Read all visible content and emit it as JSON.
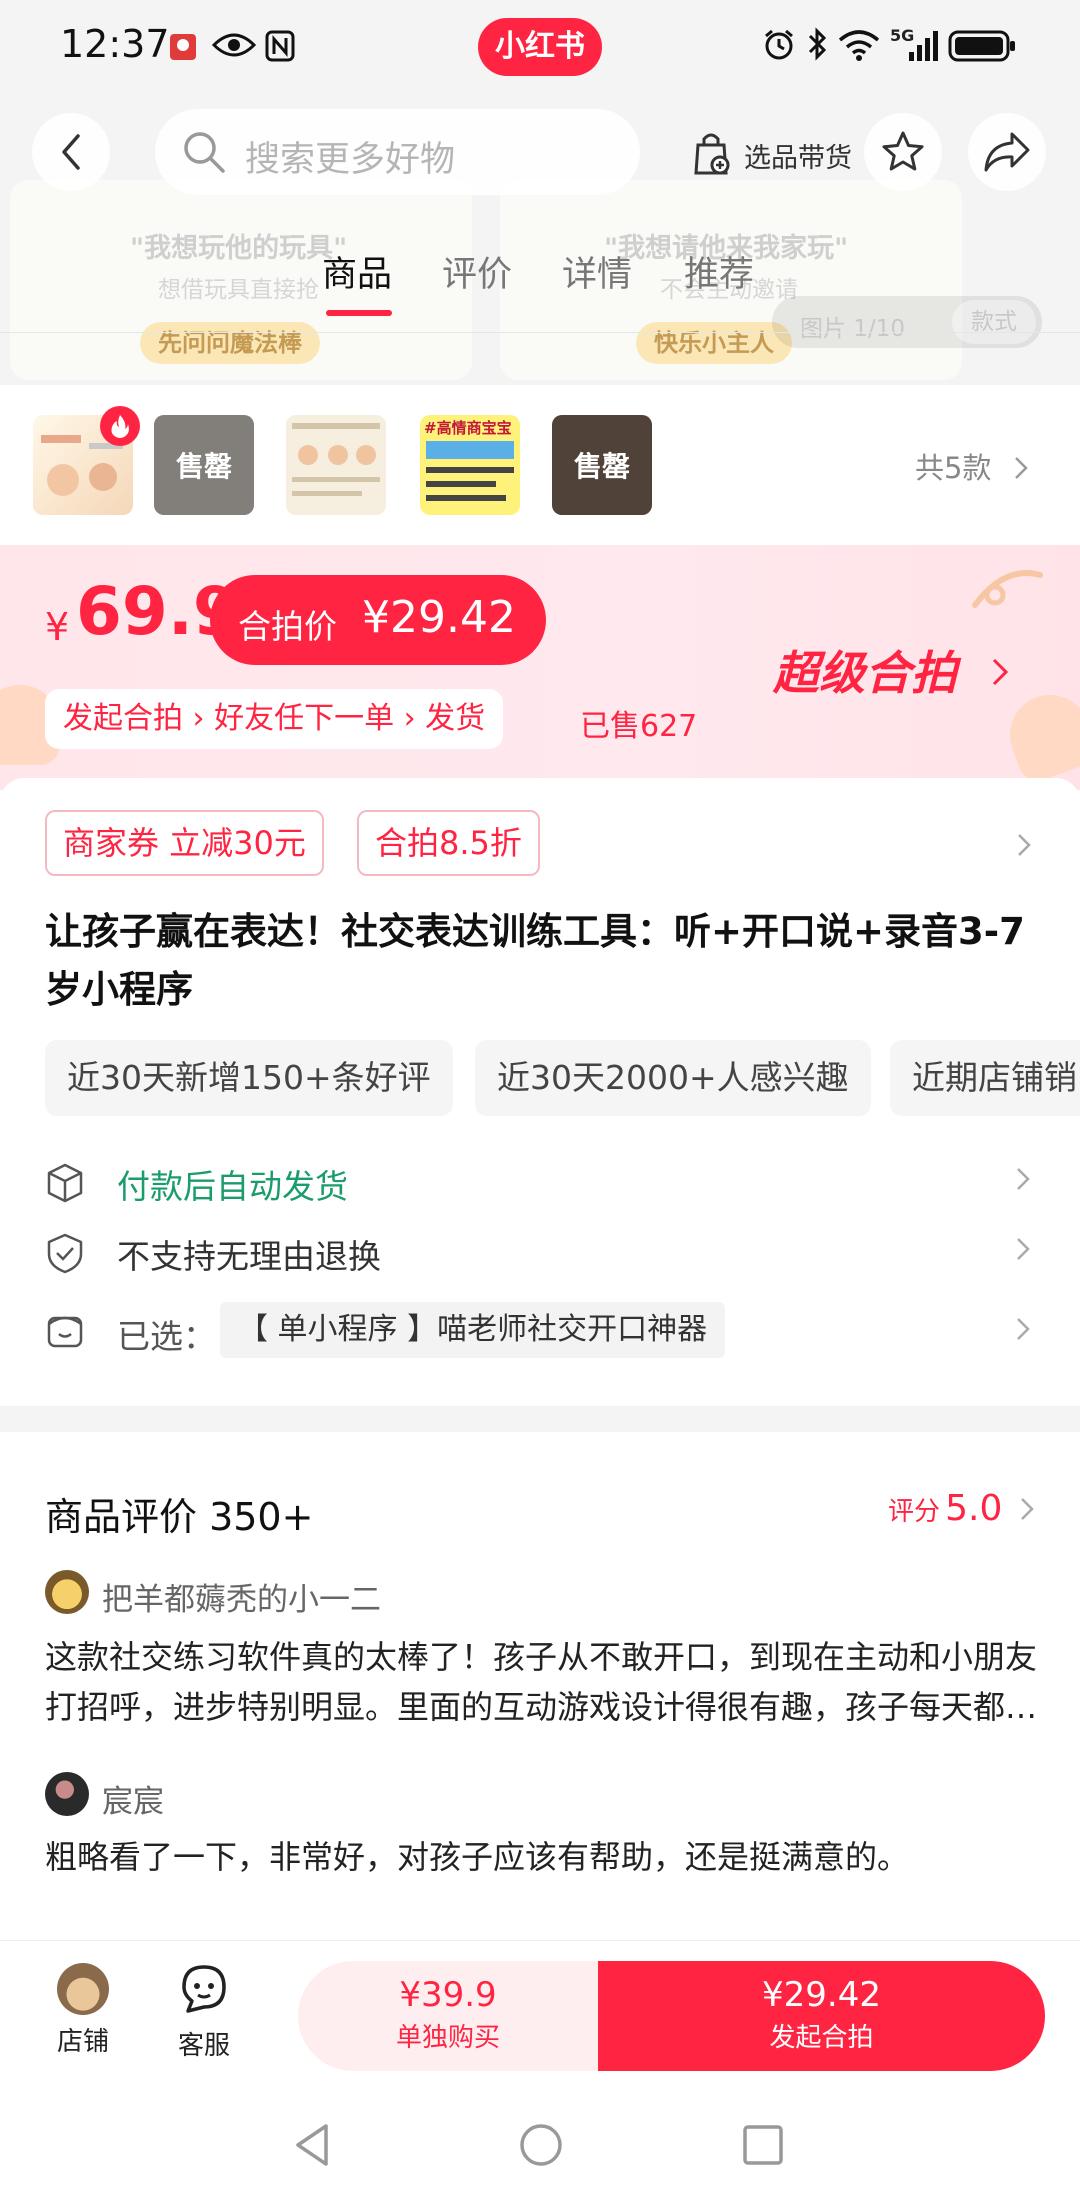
{
  "status_bar": {
    "time": "12:37",
    "brand": "小红书",
    "network": "5G"
  },
  "hero": {
    "left_caption": "\"我想玩他的玩具\"",
    "left_sub": "想借玩具直接抢",
    "left_pill": "先问问魔法棒",
    "right_caption": "\"我想请他来我家玩\"",
    "right_sub": "不会主动邀请",
    "right_pill": "快乐小主人",
    "picture_counter": "图片 1/10",
    "picture_button": "款式"
  },
  "nav": {
    "search_placeholder": "搜索更多好物",
    "select_goods_label": "选品带货"
  },
  "tabs": [
    {
      "label": "商品"
    },
    {
      "label": "评价"
    },
    {
      "label": "详情"
    },
    {
      "label": "推荐"
    }
  ],
  "variants": {
    "sold_label": "售罄",
    "thumb_4_text": "#高情商宝宝",
    "count_label": "共5款"
  },
  "price": {
    "currency": "¥",
    "main": "69.9",
    "group_label": "合拍价",
    "group_price": "¥29.42",
    "flow_text": "发起合拍 › 好友任下一单 › 发货",
    "sold": "已售627",
    "super_label": "超级合拍"
  },
  "product": {
    "coupons": [
      "商家券 立减30元",
      "合拍8.5折"
    ],
    "title": "让孩子赢在表达！社交表达训练工具：听+开口说+录音3-7岁小程序",
    "tags": [
      "近30天新增150+条好评",
      "近30天2000+人感兴趣",
      "近期店铺销"
    ],
    "service_shipping": "付款后自动发货",
    "service_return": "不支持无理由退换",
    "selected_label": "已选：",
    "selected_value": "【 单小程序 】喵老师社交开口神器"
  },
  "reviews": {
    "title": "商品评价 350+",
    "score_label": "评分",
    "score_value": "5.0",
    "items": [
      {
        "user": "把羊都薅秃的小一二",
        "text": "这款社交练习软件真的太棒了！孩子从不敢开口，到现在主动和小朋友打招呼，进步特别明显。里面的互动游戏设计得很有趣，孩子每天都主动要玩。"
      },
      {
        "user": "宸宸",
        "text": "粗略看了一下，非常好，对孩子应该有帮助，还是挺满意的。"
      }
    ]
  },
  "bottom_bar": {
    "shop_label": "店铺",
    "service_label": "客服",
    "buy_alone_price": "¥39.9",
    "buy_alone_label": "单独购买",
    "buy_group_price": "¥29.42",
    "buy_group_label": "发起合拍"
  },
  "colors": {
    "accent": "#ff2442",
    "green": "#1a9c6b",
    "banner_bg": "#ffe6ea"
  }
}
